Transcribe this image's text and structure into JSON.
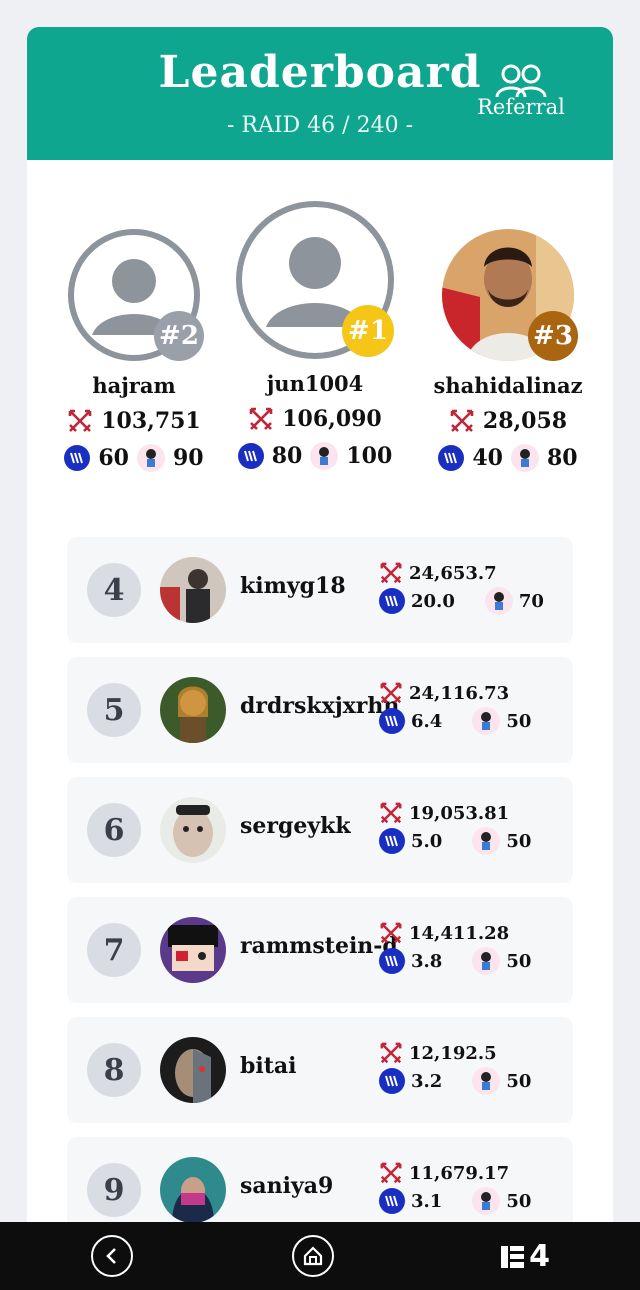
{
  "header": {
    "title": "Leaderboard",
    "subtitle": "- RAID 46 / 240 -",
    "referral_label": "Referral",
    "bg_color": "#0ea68e"
  },
  "podium": [
    {
      "rank_label": "#2",
      "name": "hajram",
      "damage": "103,751",
      "steem": "60",
      "token": "90",
      "badge_color": "#9aa0aa",
      "avatar": "default-avatar-icon"
    },
    {
      "rank_label": "#1",
      "name": "jun1004",
      "damage": "106,090",
      "steem": "80",
      "token": "100",
      "badge_color": "#f5c518",
      "avatar": "default-avatar-icon"
    },
    {
      "rank_label": "#3",
      "name": "shahidalinaz",
      "damage": "28,058",
      "steem": "40",
      "token": "80",
      "badge_color": "#a9650f",
      "avatar": "user-photo"
    }
  ],
  "rows": [
    {
      "rank": "4",
      "name": "kimyg18",
      "damage": "24,653.7",
      "steem": "20.0",
      "token": "70"
    },
    {
      "rank": "5",
      "name": "drdrskxjxrhn",
      "damage": "24,116.73",
      "steem": "6.4",
      "token": "50"
    },
    {
      "rank": "6",
      "name": "sergeykk",
      "damage": "19,053.81",
      "steem": "5.0",
      "token": "50"
    },
    {
      "rank": "7",
      "name": "rammstein-dj",
      "damage": "14,411.28",
      "steem": "3.8",
      "token": "50"
    },
    {
      "rank": "8",
      "name": "bitai",
      "damage": "12,192.5",
      "steem": "3.2",
      "token": "50"
    },
    {
      "rank": "9",
      "name": "saniya9",
      "damage": "11,679.17",
      "steem": "3.1",
      "token": "50"
    }
  ],
  "navbar": {
    "back": "back-icon",
    "home": "home-icon",
    "logo_text": "4"
  },
  "icons": {
    "damage": "crossed-swords-icon",
    "steem": "steem-icon",
    "token": "token-icon"
  }
}
